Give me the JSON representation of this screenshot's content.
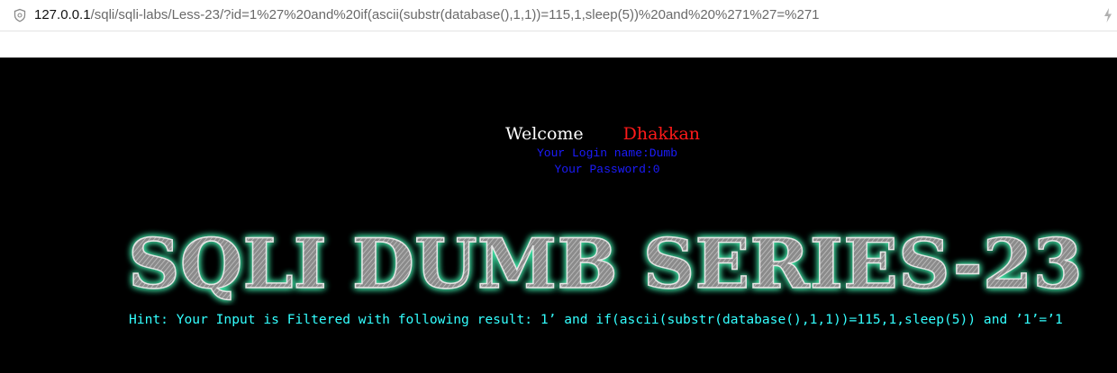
{
  "browser": {
    "url_host": "127.0.0.1",
    "url_path": "/sqli/sqli-labs/Less-23/?id=1%27%20and%20if(ascii(substr(database(),1,1))=115,1,sleep(5))%20and%20%271%27=%271",
    "shield_icon": "shield-icon",
    "bolt_icon": "lightning-icon"
  },
  "welcome": {
    "label": "Welcome",
    "user": "Dhakkan"
  },
  "login": {
    "name_line": "Your Login name:Dumb",
    "password_line": "Your Password:0"
  },
  "banner": {
    "title": "SQLI DUMB SERIES-23",
    "glow_color": "#3fe3a6"
  },
  "hint": {
    "text": "Hint: Your Input is Filtered with following result: 1’ and if(ascii(substr(database(),1,1))=115,1,sleep(5)) and ’1’=’1"
  },
  "colors": {
    "welcome": "#ffffff",
    "user": "#ff1a1a",
    "login": "#1c1cff",
    "hint": "#33ffff",
    "background": "#000000"
  }
}
